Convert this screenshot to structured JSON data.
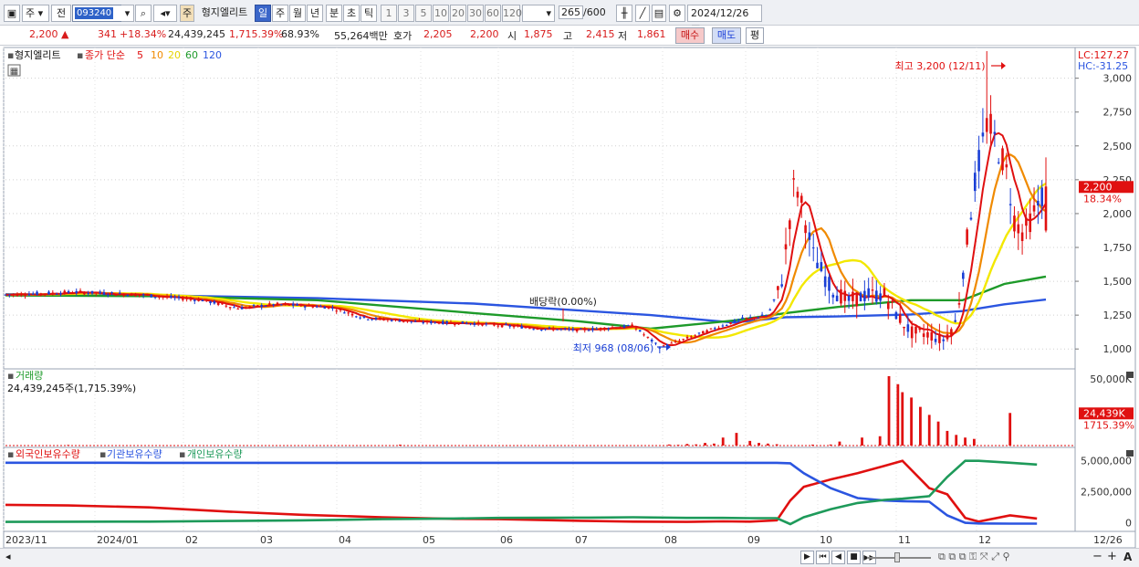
{
  "toolbar": {
    "period_type": "주",
    "prefix": "전",
    "stock_code": "093240",
    "stock_tag": "주",
    "stock_name": "형지엘리트",
    "intervals": [
      "일",
      "주",
      "월",
      "년",
      "분",
      "초",
      "틱"
    ],
    "active_interval": "일",
    "minute_options": [
      "1",
      "3",
      "5",
      "10",
      "20",
      "30",
      "60",
      "120"
    ],
    "count_display": "265",
    "count_total": "/600",
    "date": "2024/12/26"
  },
  "quote": {
    "price": "2,200",
    "arrow": "▲",
    "change": "341",
    "change_pct": "+18.34%",
    "volume": "24,439,245",
    "volume_ratio": "1,715.39%",
    "ratio2": "68.93%",
    "amount": "55,264백만",
    "bid_label": "호가",
    "bid1": "2,205",
    "bid2": "2,200",
    "open_label": "시",
    "open": "1,875",
    "high_label": "고",
    "high": "2,415",
    "low_label": "저",
    "low": "1,861",
    "buy_label": "매수",
    "sell_label": "매도",
    "eval_label": "평"
  },
  "colors": {
    "up": "#e01010",
    "down": "#1a3fd6",
    "ma5": "#e01010",
    "ma10": "#f08a00",
    "ma20": "#f3e800",
    "ma60": "#1e9a2a",
    "ma120": "#2b55e0",
    "foreign": "#e01010",
    "institution": "#2b55e0",
    "individual": "#1e9a5a"
  },
  "chart_data": [
    {
      "type": "candlestick",
      "title": "형지엘리트",
      "legend": [
        "종가 단순",
        "5",
        "10",
        "20",
        "60",
        "120"
      ],
      "y_ticks": [
        1000,
        1250,
        1500,
        1750,
        2000,
        2250,
        2500,
        2750,
        3000
      ],
      "y_tick_labels": [
        "1,000",
        "1,250",
        "1,500",
        "1,750",
        "2,000",
        "2,250",
        "2,500",
        "2,750",
        "3,000"
      ],
      "ylim": [
        880,
        3200
      ],
      "x_labels": [
        "2023/11",
        "2024/01",
        "02",
        "03",
        "04",
        "05",
        "06",
        "07",
        "08",
        "09",
        "10",
        "11",
        "12",
        "12/26"
      ],
      "lc": "LC:127.27",
      "hc": "HC:-31.25",
      "last_price": "2,200",
      "last_change_pct": "18.34%",
      "annotations": {
        "high": "최고 3,200 (12/11)",
        "low": "최저 968 (08/06)",
        "dividend": "배당락(0.00%)"
      },
      "series_keypoints": {
        "ma120": [
          [
            0,
            1405
          ],
          [
            0.15,
            1395
          ],
          [
            0.3,
            1375
          ],
          [
            0.45,
            1335
          ],
          [
            0.55,
            1285
          ],
          [
            0.62,
            1250
          ],
          [
            0.7,
            1195
          ],
          [
            0.75,
            1235
          ],
          [
            0.8,
            1240
          ],
          [
            0.87,
            1255
          ],
          [
            0.92,
            1280
          ],
          [
            0.96,
            1330
          ],
          [
            1,
            1365
          ]
        ],
        "ma60": [
          [
            0,
            1395
          ],
          [
            0.15,
            1390
          ],
          [
            0.3,
            1360
          ],
          [
            0.45,
            1265
          ],
          [
            0.55,
            1205
          ],
          [
            0.62,
            1150
          ],
          [
            0.7,
            1210
          ],
          [
            0.75,
            1265
          ],
          [
            0.8,
            1310
          ],
          [
            0.87,
            1360
          ],
          [
            0.92,
            1360
          ],
          [
            0.96,
            1480
          ],
          [
            1,
            1535
          ]
        ]
      },
      "current_values": {
        "ma5": 2000,
        "ma10": 2150,
        "ma20": 1800,
        "ma60": 1535,
        "ma120": 1365
      }
    },
    {
      "type": "bar",
      "title": "거래량",
      "summary": "24,439,245주(1,715.39%)",
      "y_tick_labels": [
        "50,000K"
      ],
      "last_value_label": "24,439K",
      "last_pct_label": "1715.39%",
      "ylim": [
        0,
        52000
      ],
      "spikes_k": [
        [
          0.07,
          500
        ],
        [
          0.44,
          700
        ],
        [
          0.74,
          800
        ],
        [
          0.75,
          600
        ],
        [
          0.76,
          1200
        ],
        [
          0.77,
          900
        ],
        [
          0.78,
          2000
        ],
        [
          0.79,
          1500
        ],
        [
          0.8,
          6000
        ],
        [
          0.815,
          9500
        ],
        [
          0.83,
          3500
        ],
        [
          0.84,
          2000
        ],
        [
          0.85,
          1500
        ],
        [
          0.86,
          1000
        ],
        [
          0.9,
          700
        ],
        [
          0.92,
          800
        ],
        [
          0.93,
          3000
        ],
        [
          0.955,
          6000
        ],
        [
          0.975,
          7000
        ],
        [
          0.985,
          52000
        ],
        [
          0.995,
          46000
        ],
        [
          1.0,
          40000
        ],
        [
          1.01,
          36000
        ],
        [
          1.02,
          29000
        ],
        [
          1.03,
          23000
        ],
        [
          1.04,
          18000
        ],
        [
          1.05,
          11000
        ],
        [
          1.06,
          8000
        ],
        [
          1.07,
          6000
        ],
        [
          1.08,
          5000
        ],
        [
          1.12,
          24439
        ]
      ]
    },
    {
      "type": "line",
      "series": [
        {
          "name": "외국인보유수량",
          "values": [
            1450000,
            1400000,
            1250000,
            900000,
            650000,
            450000,
            320000,
            300000,
            150000,
            100000,
            80000,
            120000,
            100000,
            200000,
            1800000,
            2900000,
            3500000,
            4000000,
            4600000,
            5000000,
            2800000,
            2300000,
            400000,
            100000,
            600000,
            350000
          ]
        },
        {
          "name": "기관보유수량",
          "values": [
            4850000,
            4850000,
            4840000,
            4840000,
            4840000,
            4840000,
            4840000,
            4840000,
            4840000,
            4840000,
            4840000,
            4840000,
            4840000,
            4840000,
            4800000,
            4000000,
            2800000,
            2000000,
            1800000,
            1750000,
            1700000,
            600000,
            0,
            -50000,
            -60000,
            -60000
          ]
        },
        {
          "name": "개인보유수량",
          "values": [
            80000,
            90000,
            100000,
            150000,
            200000,
            300000,
            350000,
            400000,
            420000,
            450000,
            400000,
            400000,
            380000,
            380000,
            -100000,
            450000,
            1100000,
            1600000,
            1850000,
            1950000,
            2150000,
            3700000,
            5000000,
            5000000,
            4850000,
            4700000
          ]
        }
      ],
      "y_ticks": [
        0,
        2500000,
        5000000
      ],
      "y_tick_labels": [
        "0",
        "2,500,000",
        "5,000,000"
      ]
    }
  ],
  "bottom": {
    "nav_buttons": [
      "▶",
      "⏮",
      "◀",
      "■",
      "▶▶"
    ],
    "zoom_minus": "−",
    "zoom_plus": "+",
    "text_tool": "A"
  }
}
